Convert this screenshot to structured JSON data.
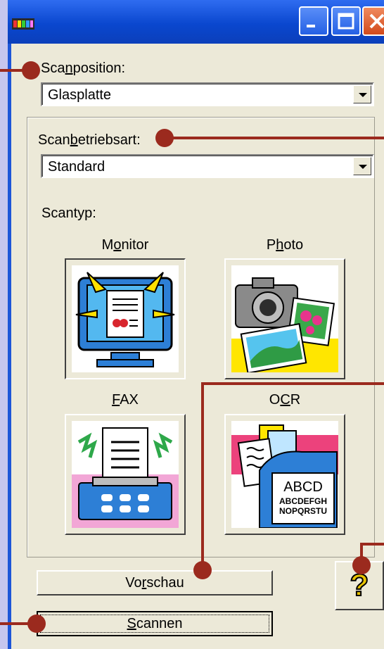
{
  "window": {
    "title": ""
  },
  "scan_position": {
    "label_prefix": "Sca",
    "label_accel": "n",
    "label_suffix": "position:",
    "value": "Glasplatte"
  },
  "scan_mode": {
    "label_prefix": "Scan",
    "label_accel": "b",
    "label_suffix": "etriebsart:",
    "value": "Standard"
  },
  "scan_type": {
    "label": "Scantyp:",
    "tiles": [
      {
        "prefix": "M",
        "accel": "o",
        "suffix": "nitor",
        "icon": "monitor-document-icon",
        "selected": true
      },
      {
        "prefix": "P",
        "accel": "h",
        "suffix": "oto",
        "icon": "camera-photos-icon",
        "selected": false
      },
      {
        "prefix": "",
        "accel": "F",
        "suffix": "AX",
        "icon": "fax-machine-icon",
        "selected": false
      },
      {
        "prefix": "O",
        "accel": "C",
        "suffix": "R",
        "icon": "ocr-documents-icon",
        "selected": false
      }
    ],
    "ocr_text": [
      "ABCD",
      "ABCDEFGH",
      "NOPQRSTU"
    ]
  },
  "buttons": {
    "preview": {
      "prefix": "Vo",
      "accel": "r",
      "suffix": "schau"
    },
    "scan": {
      "prefix": "",
      "accel": "S",
      "suffix": "cannen"
    },
    "help": "?"
  },
  "colors": {
    "callout": "#9b2a1e",
    "titlebar": "#0a47cf",
    "client": "#ece9d8"
  }
}
